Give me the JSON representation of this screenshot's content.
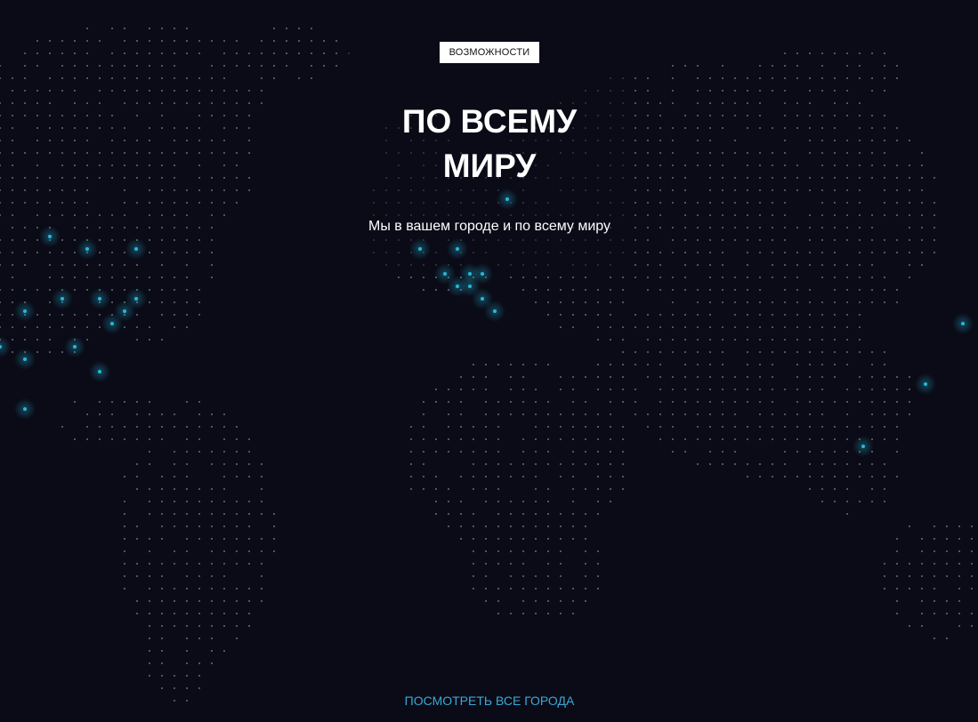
{
  "badge": {
    "label": "ВОЗМОЖНОСТИ"
  },
  "hero": {
    "title_line1": "ПО ВСЕМУ",
    "title_line2": "МИРУ",
    "subtitle": "Мы в вашем городе и по всему миру"
  },
  "link": {
    "label": "ПОСМОТРЕТЬ ВСЕ ГОРОДА"
  },
  "colors": {
    "background": "#0a0b17",
    "map_dot": "#8a8d99",
    "city_dot": "#25b8d9",
    "link": "#3aa9d6"
  }
}
